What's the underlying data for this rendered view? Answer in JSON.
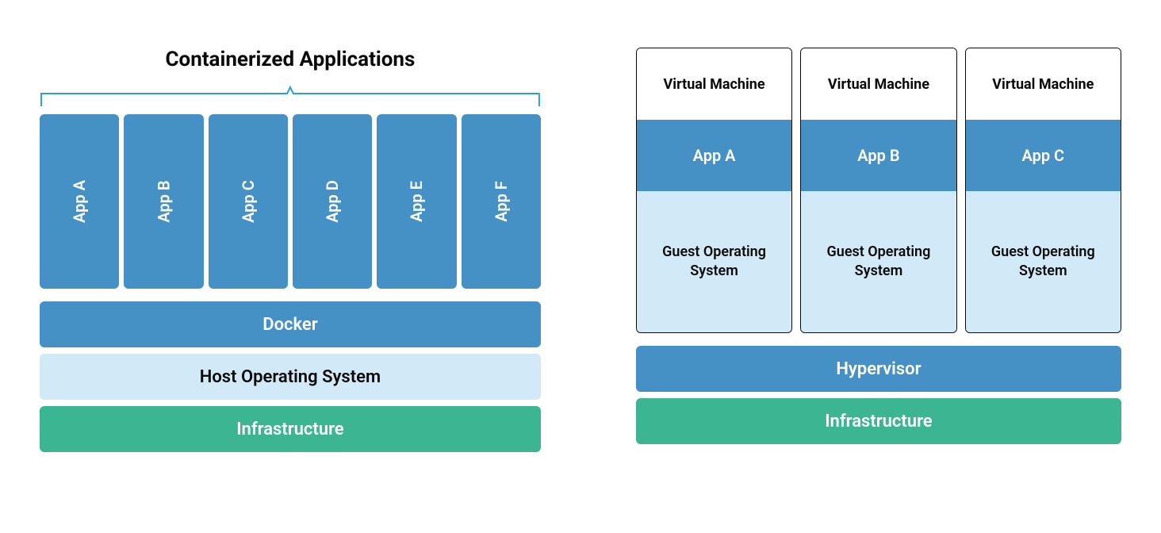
{
  "left": {
    "title": "Containerized Applications",
    "apps": [
      "App A",
      "App B",
      "App C",
      "App D",
      "App E",
      "App F"
    ],
    "docker": "Docker",
    "host_os": "Host Operating System",
    "infrastructure": "Infrastructure"
  },
  "right": {
    "vms": [
      {
        "header": "Virtual Machine",
        "app": "App A",
        "guest": "Guest Operating System"
      },
      {
        "header": "Virtual Machine",
        "app": "App B",
        "guest": "Guest Operating System"
      },
      {
        "header": "Virtual Machine",
        "app": "App C",
        "guest": "Guest Operating System"
      }
    ],
    "hypervisor": "Hypervisor",
    "infrastructure": "Infrastructure"
  },
  "colors": {
    "blue": "#4590c4",
    "light": "#d2e9f7",
    "green": "#3cb592",
    "bracket": "#2aa0d8"
  }
}
